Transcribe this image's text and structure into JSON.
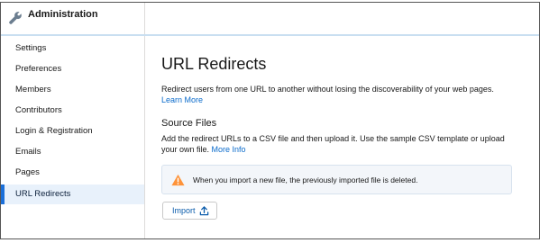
{
  "app": {
    "title": "Administration",
    "icon": "wrench-icon"
  },
  "sidebar": {
    "items": [
      {
        "label": "Settings",
        "active": false
      },
      {
        "label": "Preferences",
        "active": false
      },
      {
        "label": "Members",
        "active": false
      },
      {
        "label": "Contributors",
        "active": false
      },
      {
        "label": "Login & Registration",
        "active": false
      },
      {
        "label": "Emails",
        "active": false
      },
      {
        "label": "Pages",
        "active": false
      },
      {
        "label": "URL Redirects",
        "active": true
      }
    ]
  },
  "main": {
    "title": "URL Redirects",
    "description": "Redirect users from one URL to another without losing the discoverability of your web pages.",
    "learn_more": "Learn More",
    "section_title": "Source Files",
    "section_description": "Add the redirect URLs to a CSV file and then upload it. Use the sample CSV template or upload your own file.",
    "more_info": "More Info",
    "alert": {
      "icon": "warning-icon",
      "message": "When you import a new file, the previously imported file is deleted."
    },
    "import_button": {
      "label": "Import",
      "icon": "upload-icon"
    }
  },
  "colors": {
    "accent": "#1b6fd8",
    "link": "#0b6bcb",
    "active_bg": "#e8f1fb",
    "warning": "#fe9339"
  }
}
